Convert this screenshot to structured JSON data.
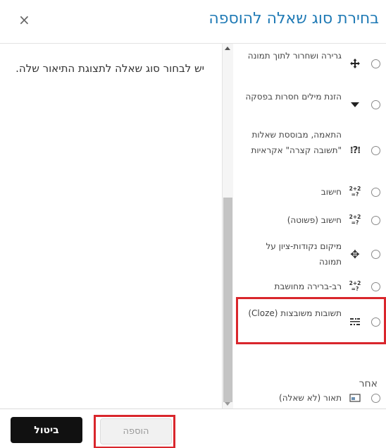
{
  "dialog": {
    "title": "בחירת סוג שאלה להוספה",
    "close_glyph": "×"
  },
  "description": "יש לבחור סוג שאלה לתצוגת התיאור שלה.",
  "question_types": [
    {
      "label": "גרירה ושחרור לתוך תמונה",
      "icon": "move-arrows-icon",
      "glyph": "✚"
    },
    {
      "label": "הזנת מילים חסרות בפסקה",
      "icon": "dropdown-triangle-icon",
      "glyph": "▼"
    },
    {
      "label": "התאמה, מבוססת שאלות \"תשובה קצרה\" אקראיות",
      "icon": "random-match-icon",
      "glyph": "⁞?⁞"
    },
    {
      "label": "חישוב",
      "icon": "calculated-icon",
      "glyph": "2+2=?"
    },
    {
      "label": "חישוב (פשוטה)",
      "icon": "calculated-simple-icon",
      "glyph": "2+2=?"
    },
    {
      "label": "מיקום נקודות-ציון על תמונה",
      "icon": "drag-markers-icon",
      "glyph": "✥"
    },
    {
      "label": "רב-ברירה מחושבת",
      "icon": "calculated-multichoice-icon",
      "glyph": "2+2=?"
    },
    {
      "label": "תשובות משובצות (Cloze)",
      "icon": "cloze-icon",
      "glyph": "⋯"
    }
  ],
  "other_section": {
    "heading": "אחר",
    "items": [
      {
        "label": "תאור (לא שאלה)",
        "icon": "description-icon",
        "glyph": "▣"
      }
    ]
  },
  "footer": {
    "cancel_label": "ביטול",
    "add_label": "הוספה"
  },
  "colors": {
    "title": "#1f7ab5",
    "highlight": "#d9262c",
    "cancel_bg": "#111111"
  }
}
